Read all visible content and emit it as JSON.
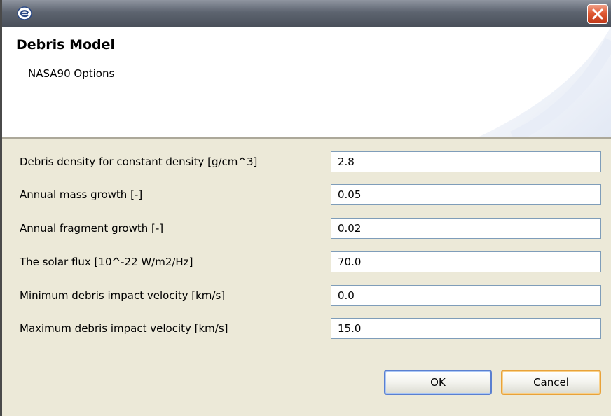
{
  "window": {
    "app_icon": "eclipse-e-icon",
    "close_icon": "close-x-icon"
  },
  "header": {
    "title": "Debris Model",
    "subtitle": "NASA90 Options"
  },
  "fields": [
    {
      "label": "Debris density for constant density [g/cm^3]",
      "value": "2.8"
    },
    {
      "label": "Annual mass growth [-]",
      "value": "0.05"
    },
    {
      "label": "Annual fragment growth [-]",
      "value": "0.02"
    },
    {
      "label": "The solar flux [10^-22 W/m2/Hz]",
      "value": "70.0"
    },
    {
      "label": "Minimum debris impact velocity [km/s]",
      "value": "0.0"
    },
    {
      "label": "Maximum debris impact velocity [km/s]",
      "value": "15.0"
    }
  ],
  "buttons": {
    "ok": "OK",
    "cancel": "Cancel"
  },
  "colors": {
    "close_button": "#e05a34",
    "ok_border": "#5a7fd0",
    "cancel_border": "#e8a23a"
  }
}
